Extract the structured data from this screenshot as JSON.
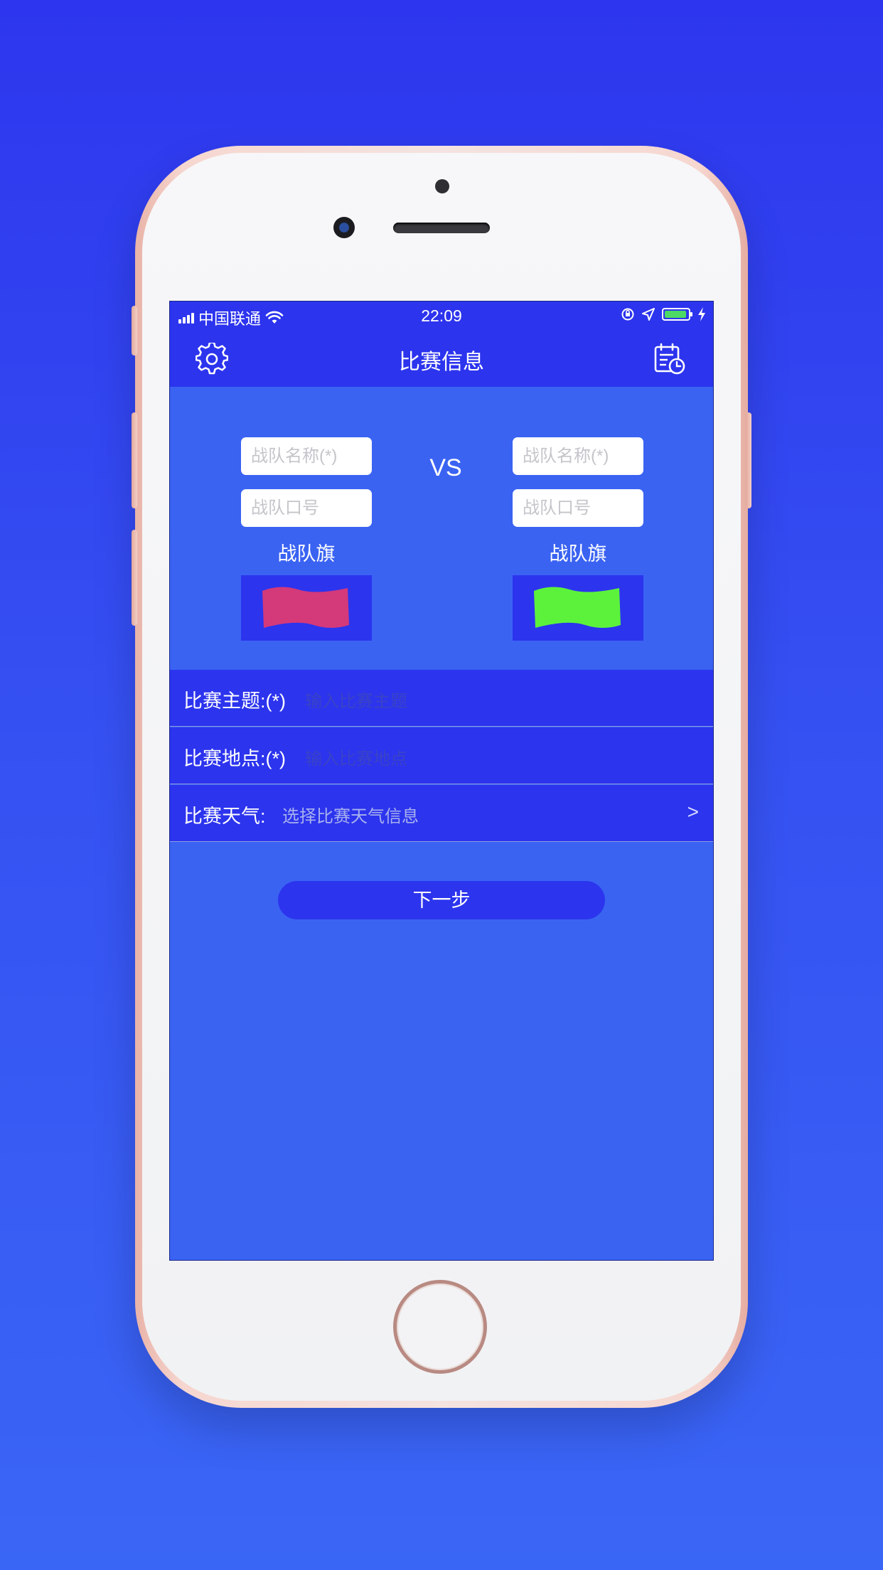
{
  "status_bar": {
    "carrier": "中国联通",
    "time": "22:09",
    "battery_color": "#4cd964"
  },
  "nav": {
    "title": "比赛信息",
    "left_icon": "gear-icon",
    "right_icon": "calendar-clock-icon"
  },
  "teams": {
    "left": {
      "name_placeholder": "战队名称(*)",
      "slogan_placeholder": "战队口号",
      "flag_label": "战队旗",
      "flag_color": "#d4397a"
    },
    "vs": "VS",
    "right": {
      "name_placeholder": "战队名称(*)",
      "slogan_placeholder": "战队口号",
      "flag_label": "战队旗",
      "flag_color": "#5cf23c"
    }
  },
  "form": {
    "theme": {
      "label": "比赛主题:(*)",
      "placeholder": "输入比赛主题"
    },
    "location": {
      "label": "比赛地点:(*)",
      "placeholder": "输入比赛地点"
    },
    "weather": {
      "label": "比赛天气:",
      "value": "选择比赛天气信息",
      "chevron": ">"
    }
  },
  "next_button": "下一步",
  "colors": {
    "page_background": "#3550f2",
    "nav_background": "#2c34ee",
    "content_background": "#3a63f2"
  }
}
